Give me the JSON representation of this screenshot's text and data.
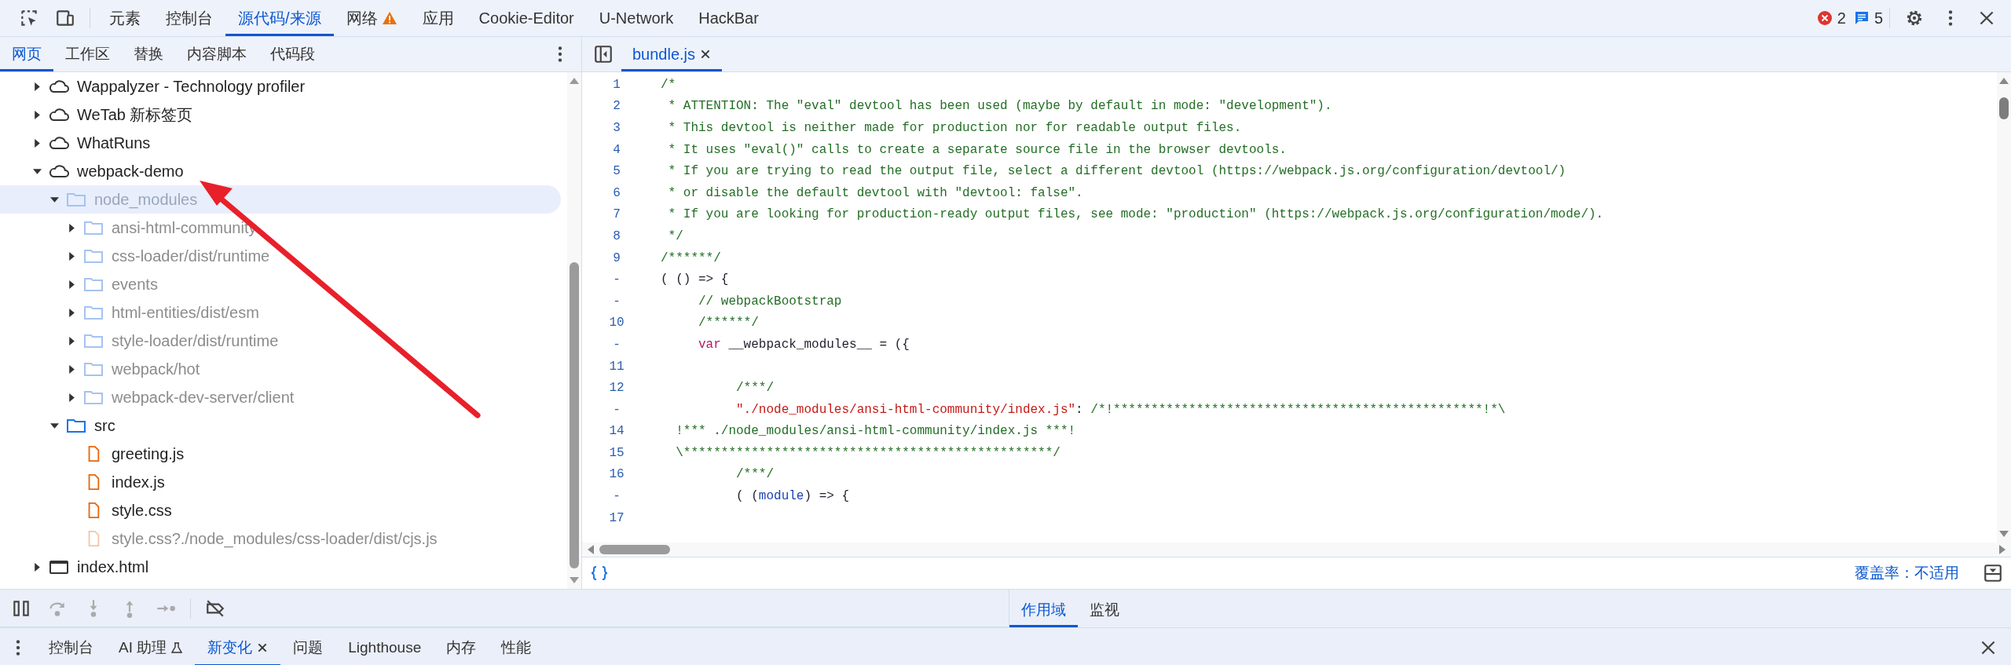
{
  "toolbar": {
    "tabs": [
      {
        "label": "元素",
        "selected": false,
        "warning": false
      },
      {
        "label": "控制台",
        "selected": false,
        "warning": false
      },
      {
        "label": "源代码/来源",
        "selected": true,
        "warning": false
      },
      {
        "label": "网络",
        "selected": false,
        "warning": true
      },
      {
        "label": "应用",
        "selected": false,
        "warning": false
      },
      {
        "label": "Cookie-Editor",
        "selected": false,
        "warning": false
      },
      {
        "label": "U-Network",
        "selected": false,
        "warning": false
      },
      {
        "label": "HackBar",
        "selected": false,
        "warning": false
      }
    ],
    "errors": "2",
    "messages": "5"
  },
  "navigator": {
    "tabs": [
      {
        "label": "网页",
        "selected": true
      },
      {
        "label": "工作区",
        "selected": false
      },
      {
        "label": "替换",
        "selected": false
      },
      {
        "label": "内容脚本",
        "selected": false
      },
      {
        "label": "代码段",
        "selected": false
      }
    ],
    "tree": [
      {
        "label": "Wappalyzer - Technology profiler",
        "kind": "cloud",
        "expanded": false,
        "dimmed": false,
        "selected": false
      },
      {
        "label": "WeTab 新标签页",
        "kind": "cloud",
        "expanded": false,
        "dimmed": false,
        "selected": false
      },
      {
        "label": "WhatRuns",
        "kind": "cloud",
        "expanded": false,
        "dimmed": false,
        "selected": false
      },
      {
        "label": "webpack-demo",
        "kind": "cloud",
        "expanded": true,
        "dimmed": false,
        "selected": false,
        "children": [
          {
            "label": "node_modules",
            "kind": "folder",
            "expanded": true,
            "dimmed": true,
            "selected": true,
            "children": [
              {
                "label": "ansi-html-community",
                "kind": "folder",
                "expanded": false,
                "dimmed": true,
                "selected": false
              },
              {
                "label": "css-loader/dist/runtime",
                "kind": "folder",
                "expanded": false,
                "dimmed": true,
                "selected": false
              },
              {
                "label": "events",
                "kind": "folder",
                "expanded": false,
                "dimmed": true,
                "selected": false
              },
              {
                "label": "html-entities/dist/esm",
                "kind": "folder",
                "expanded": false,
                "dimmed": true,
                "selected": false
              },
              {
                "label": "style-loader/dist/runtime",
                "kind": "folder",
                "expanded": false,
                "dimmed": true,
                "selected": false
              },
              {
                "label": "webpack/hot",
                "kind": "folder",
                "expanded": false,
                "dimmed": true,
                "selected": false
              },
              {
                "label": "webpack-dev-server/client",
                "kind": "folder",
                "expanded": false,
                "dimmed": true,
                "selected": false
              }
            ]
          },
          {
            "label": "src",
            "kind": "folder",
            "expanded": true,
            "dimmed": false,
            "selected": false,
            "children": [
              {
                "label": "greeting.js",
                "kind": "file",
                "dimmed": false,
                "selected": false
              },
              {
                "label": "index.js",
                "kind": "file",
                "dimmed": false,
                "selected": false
              },
              {
                "label": "style.css",
                "kind": "file",
                "dimmed": false,
                "selected": false
              },
              {
                "label": "style.css?./node_modules/css-loader/dist/cjs.js",
                "kind": "file",
                "dimmed": true,
                "selected": false
              }
            ]
          }
        ]
      },
      {
        "label": "index.html",
        "kind": "frame",
        "expanded": false,
        "dimmed": false,
        "selected": false
      }
    ]
  },
  "editor": {
    "tabs": [
      {
        "label": "bundle.js",
        "selected": true,
        "closable": true
      }
    ],
    "lines": [
      {
        "number": "1",
        "tokens": [
          {
            "text": "/*",
            "kind": "comment"
          }
        ]
      },
      {
        "number": "2",
        "tokens": [
          {
            "text": " * ATTENTION: The \"eval\" devtool has been used (maybe by default in mode: \"development\").",
            "kind": "comment"
          }
        ]
      },
      {
        "number": "3",
        "tokens": [
          {
            "text": " * This devtool is neither made for production nor for readable output files.",
            "kind": "comment"
          }
        ]
      },
      {
        "number": "4",
        "tokens": [
          {
            "text": " * It uses \"eval()\" calls to create a separate source file in the browser devtools.",
            "kind": "comment"
          }
        ]
      },
      {
        "number": "5",
        "tokens": [
          {
            "text": " * If you are trying to read the output file, select a different devtool (https://webpack.js.org/configuration/devtool/)",
            "kind": "comment"
          }
        ]
      },
      {
        "number": "6",
        "tokens": [
          {
            "text": " * or disable the default devtool with \"devtool: false\".",
            "kind": "comment"
          }
        ]
      },
      {
        "number": "7",
        "tokens": [
          {
            "text": " * If you are looking for production-ready output files, see mode: \"production\" (https://webpack.js.org/configuration/mode/).",
            "kind": "comment"
          }
        ]
      },
      {
        "number": "8",
        "tokens": [
          {
            "text": " */",
            "kind": "comment"
          }
        ]
      },
      {
        "number": "9",
        "tokens": [
          {
            "text": "/******/",
            "kind": "comment"
          }
        ]
      },
      {
        "number": "-",
        "tokens": [
          {
            "text": "( () => {",
            "kind": "plain"
          }
        ]
      },
      {
        "number": "-",
        "tokens": [
          {
            "text": "     // webpackBootstrap",
            "kind": "comment"
          }
        ]
      },
      {
        "number": "10",
        "tokens": [
          {
            "text": "     /******/",
            "kind": "comment"
          }
        ]
      },
      {
        "number": "-",
        "tokens": [
          {
            "text": "     var",
            "kind": "keyword"
          },
          {
            "text": " __webpack_modules__ = ({",
            "kind": "plain"
          }
        ]
      },
      {
        "number": "11"
      },
      {
        "number": "12",
        "tokens": [
          {
            "text": "          /***/",
            "kind": "comment"
          }
        ]
      },
      {
        "number": "-",
        "tokens": [
          {
            "text": "          \"./node_modules/ansi-html-community/index.js\"",
            "kind": "string"
          },
          {
            "text": ": ",
            "kind": "plain"
          },
          {
            "text": "/*!*************************************************!*\\",
            "kind": "comment"
          }
        ]
      },
      {
        "number": "14",
        "tokens": [
          {
            "text": "  !*** ./node_modules/ansi-html-community/index.js ***!",
            "kind": "comment"
          }
        ]
      },
      {
        "number": "15",
        "tokens": [
          {
            "text": "  \\*************************************************/",
            "kind": "comment"
          }
        ]
      },
      {
        "number": "16",
        "tokens": [
          {
            "text": "          /***/",
            "kind": "comment"
          }
        ]
      },
      {
        "number": "-",
        "tokens": [
          {
            "text": "          ( (",
            "kind": "plain"
          },
          {
            "text": "module",
            "kind": "name"
          },
          {
            "text": ") => {",
            "kind": "plain"
          }
        ]
      },
      {
        "number": "17"
      }
    ],
    "coverage": "覆盖率：不适用"
  },
  "debugger": {
    "tabs": [
      {
        "label": "作用域",
        "selected": true
      },
      {
        "label": "监视",
        "selected": false
      }
    ]
  },
  "drawer": {
    "tabs": [
      {
        "label": "控制台",
        "selected": false,
        "closable": false,
        "experimental": false
      },
      {
        "label": "AI 助理",
        "selected": false,
        "closable": false,
        "experimental": true
      },
      {
        "label": "新变化",
        "selected": true,
        "closable": true,
        "experimental": false
      },
      {
        "label": "问题",
        "selected": false,
        "closable": false,
        "experimental": false
      },
      {
        "label": "Lighthouse",
        "selected": false,
        "closable": false,
        "experimental": false
      },
      {
        "label": "内存",
        "selected": false,
        "closable": false,
        "experimental": false
      },
      {
        "label": "性能",
        "selected": false,
        "closable": false,
        "experimental": false
      }
    ]
  },
  "annotations": [
    {
      "kind": "arrow",
      "color": "#e8202a"
    }
  ]
}
